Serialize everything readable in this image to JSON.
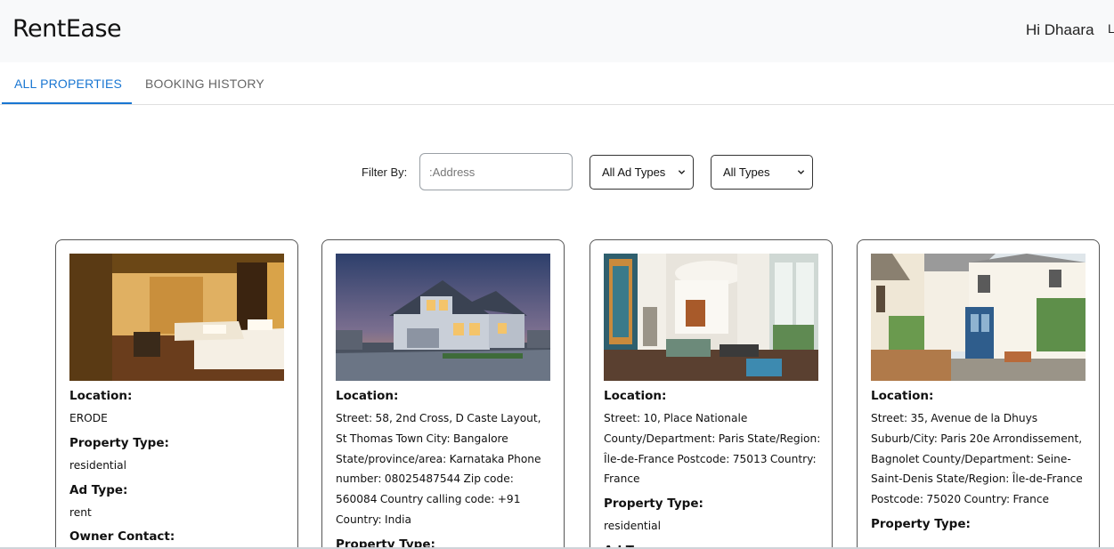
{
  "navbar": {
    "brand": "RentEase",
    "greeting": "Hi Dhaara",
    "logout_partial": "L"
  },
  "tabs": [
    {
      "label": "ALL PROPERTIES",
      "active": true
    },
    {
      "label": "BOOKING HISTORY",
      "active": false
    }
  ],
  "colors": {
    "accent": "#1976d2",
    "navbar_bg": "#f8f9fa"
  },
  "filter": {
    "label": "Filter By:",
    "address_placeholder": ":Address",
    "ad_type_selected": "All Ad Types",
    "type_selected": "All Types"
  },
  "properties": [
    {
      "image": "hotel-bedroom-photo",
      "location_label": "Location:",
      "location": "ERODE",
      "property_type_label": "Property Type:",
      "property_type": "residential",
      "ad_type_label": "Ad Type:",
      "ad_type": "rent",
      "owner_contact_label": "Owner Contact:"
    },
    {
      "image": "suburban-house-photo",
      "location_label": "Location:",
      "location": "Street: 58, 2nd Cross, D Caste Layout, St Thomas Town City: Bangalore State/province/area: Karnataka Phone number: 08025487544 Zip code: 560084 Country calling code: +91 Country: India",
      "property_type_label": "Property Type:"
    },
    {
      "image": "paris-living-room-photo",
      "location_label": "Location:",
      "location": "Street: 10, Place Nationale County/Department: Paris State/Region: Île-de-France Postcode: 75013 Country: France",
      "property_type_label": "Property Type:",
      "property_type": "residential",
      "ad_type_label": "Ad Type:"
    },
    {
      "image": "townhouse-courtyard-photo",
      "location_label": "Location:",
      "location": "Street: 35, Avenue de la Dhuys Suburb/City: Paris 20e Arrondissement, Bagnolet County/Department: Seine-Saint-Denis State/Region: Île-de-France Postcode: 75020 Country: France",
      "property_type_label": "Property Type:"
    }
  ]
}
